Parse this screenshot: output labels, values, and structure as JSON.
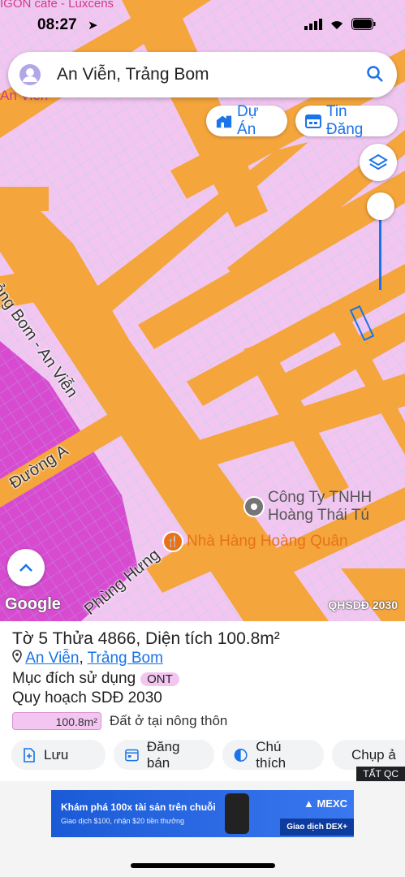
{
  "status_bar": {
    "time": "08:27",
    "background_label": "IGON cafe - Luxcens"
  },
  "search": {
    "query": "An Viễn, Trảng Bom",
    "underlay_text": "An Viễn"
  },
  "chips": {
    "du_an": "Dự Án",
    "tin_dang": "Tin Đăng"
  },
  "map": {
    "streets": {
      "main_road": "Trảng Bom - An Viễn",
      "duong_a": "Đường A",
      "phung_hung": "Phùng Hưng"
    },
    "pois": [
      {
        "name_line1": "Công Ty TNHH",
        "name_line2": "Hoàng Thái Tú",
        "icon": "place-pin-icon"
      },
      {
        "name": "Nhà Hàng Hoàng Quân",
        "icon": "restaurant-icon"
      }
    ],
    "google_label": "Google",
    "layer_label": "QHSDĐ 2030",
    "colors": {
      "land": "#f3c6f1",
      "road": "#f4a53c",
      "dense": "#d84bd1",
      "parcel_line": "#7fd3d6"
    }
  },
  "parcel": {
    "title": "Tờ 5 Thửa 4866, Diện tích 100.8m²",
    "location": {
      "ward": "An Viễn",
      "separator": ",",
      "district": "Trảng Bom"
    },
    "purpose_label": "Mục đích sử dụng",
    "purpose_code": "ONT",
    "plan_label": "Quy hoạch SDĐ 2030",
    "legend": {
      "area": "100.8m²",
      "description": "Đất ở tại nông thôn"
    }
  },
  "actions": {
    "save": "Lưu",
    "post": "Đăng bán",
    "legend": "Chú thích",
    "capture": "Chụp ả"
  },
  "ad": {
    "tag": "TẤT QC",
    "headline": "Khám phá 100x tài sản trên chuỗi",
    "subline": "Giao dịch $100, nhận $20 tiền thưởng",
    "brand": "MEXC",
    "cta": "Giao dịch DEX+"
  }
}
